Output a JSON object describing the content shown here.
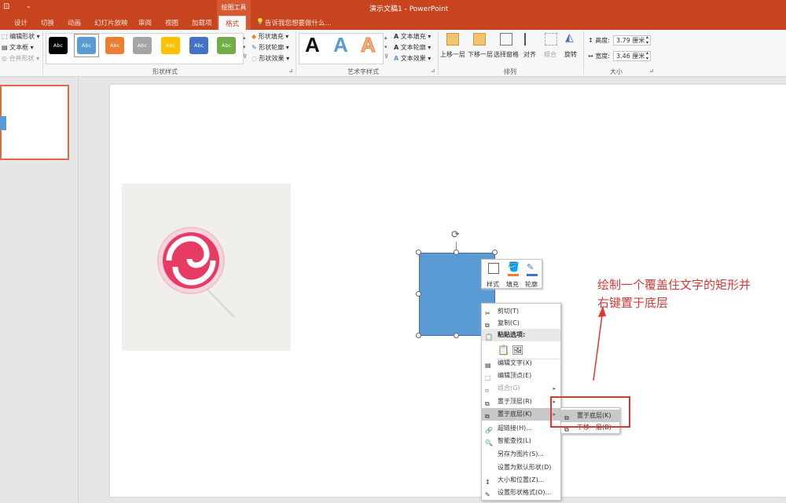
{
  "window": {
    "title": "演示文稿1 - PowerPoint"
  },
  "contextual_tab": {
    "label": "绘图工具"
  },
  "tabs": [
    "设计",
    "切换",
    "动画",
    "幻灯片放映",
    "审阅",
    "视图",
    "加载项",
    "格式"
  ],
  "active_tab": "格式",
  "tell_me": {
    "placeholder": "告诉我您想要做什么..."
  },
  "ribbon": {
    "insert_shapes": {
      "edit_shape": "编辑形状",
      "text_box": "文本框",
      "merge_shapes": "合并形状"
    },
    "shape_styles": {
      "label": "形状样式",
      "swatch_text": "Abc",
      "swatch_colors": [
        "#000000",
        "#5b9bd5",
        "#ed7d31",
        "#a5a5a5",
        "#ffc000",
        "#4472c4",
        "#70ad47"
      ],
      "fill": "形状填充",
      "outline": "形状轮廓",
      "effects": "形状效果"
    },
    "wordart_styles": {
      "label": "艺术字样式",
      "letters": [
        "A",
        "A",
        "A"
      ],
      "text_fill": "文本填充",
      "text_outline": "文本轮廓",
      "text_effects": "文本效果"
    },
    "arrange": {
      "label": "排列",
      "bring_forward": "上移一层",
      "send_backward": "下移一层",
      "selection_pane": "选择窗格",
      "align": "对齐",
      "group": "组合",
      "rotate": "旋转"
    },
    "size": {
      "label": "大小",
      "height_label": "高度:",
      "height_value": "3.79 厘米",
      "width_label": "宽度:",
      "width_value": "3.46 厘米"
    }
  },
  "mini_toolbar": {
    "style": "样式",
    "fill": "填充",
    "outline": "轮廓"
  },
  "context_menu": {
    "items": [
      {
        "label": "剪切(T)",
        "state": "normal"
      },
      {
        "label": "复制(C)",
        "state": "normal"
      },
      {
        "label": "粘贴选项:",
        "state": "header"
      },
      {
        "label": "",
        "state": "paste"
      },
      {
        "label": "编辑文字(X)",
        "state": "normal"
      },
      {
        "label": "编辑顶点(E)",
        "state": "normal"
      },
      {
        "label": "组合(G)",
        "state": "disabled"
      },
      {
        "label": "置于顶层(R)",
        "state": "normal"
      },
      {
        "label": "置于底层(K)",
        "state": "highlight"
      },
      {
        "label": "超链接(H)...",
        "state": "normal"
      },
      {
        "label": "智能查找(L)",
        "state": "normal"
      },
      {
        "label": "另存为图片(S)...",
        "state": "normal"
      },
      {
        "label": "设置为默认形状(D)",
        "state": "normal"
      },
      {
        "label": "大小和位置(Z)...",
        "state": "normal"
      },
      {
        "label": "设置形状格式(O)...",
        "state": "normal"
      }
    ]
  },
  "submenu": {
    "items": [
      "置于底层(K)",
      "下移一层(B)"
    ]
  },
  "annotation": {
    "line1": "绘制一个覆盖住文字的矩形并",
    "line2": "右键置于底层"
  },
  "colors": {
    "accent": "#c7441f",
    "shape_fill": "#5b9bd5",
    "annotation": "#d03a3a"
  }
}
